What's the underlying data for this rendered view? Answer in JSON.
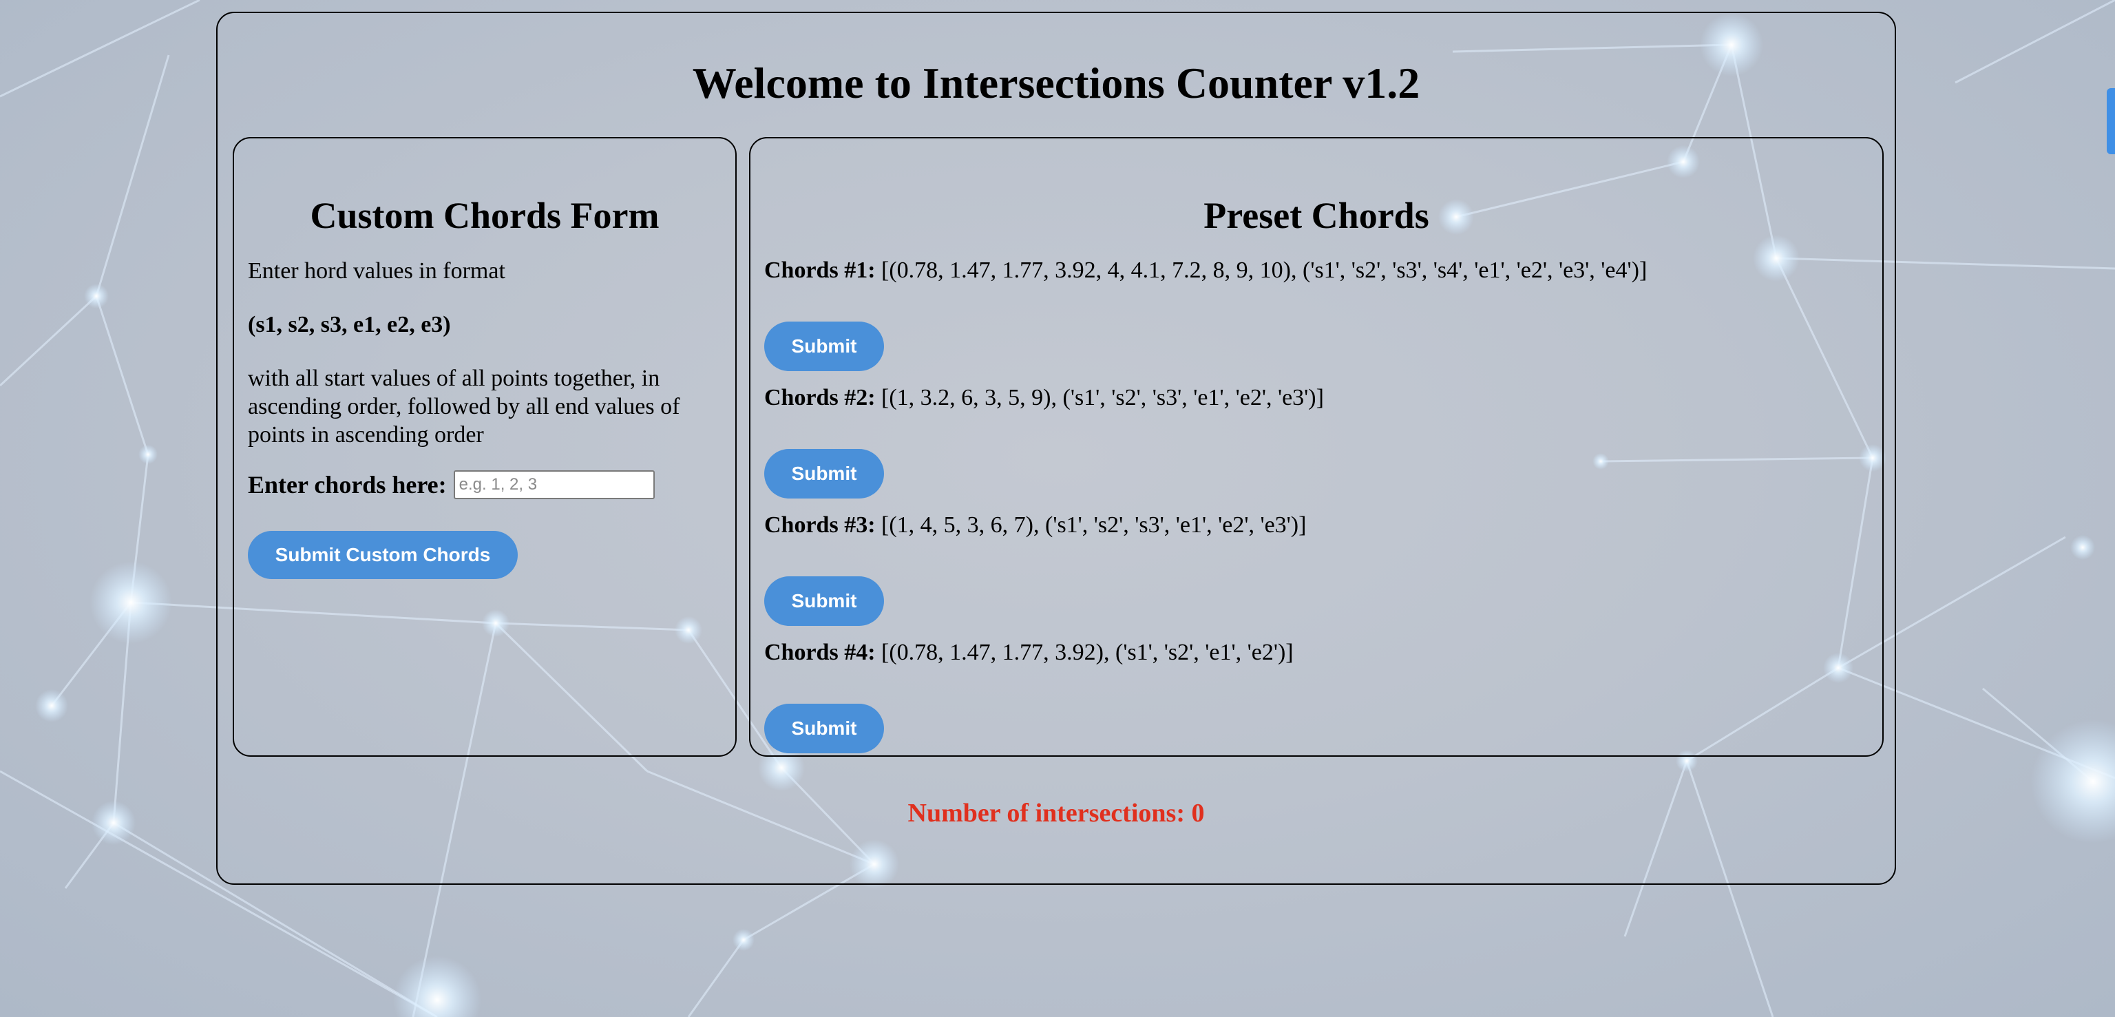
{
  "header": {
    "title": "Welcome to Intersections Counter v1.2"
  },
  "custom_form": {
    "title": "Custom Chords Form",
    "intro": "Enter hord values in format",
    "format": "(s1, s2, s3, e1, e2, e3)",
    "description": "with all start values of all points together, in ascending order, followed by all end values of points in ascending order",
    "input_label": "Enter chords here:",
    "input_placeholder": "e.g. 1, 2, 3",
    "input_value": "",
    "submit_label": "Submit Custom Chords"
  },
  "presets": {
    "title": "Preset Chords",
    "items": [
      {
        "label": "Chords #1:",
        "value": "[(0.78, 1.47, 1.77, 3.92, 4, 4.1, 7.2, 8, 9, 10), ('s1', 's2', 's3', 's4', 'e1', 'e2', 'e3', 'e4')]",
        "button": "Submit"
      },
      {
        "label": "Chords #2:",
        "value": "[(1, 3.2, 6, 3, 5, 9), ('s1', 's2', 's3', 'e1', 'e2', 'e3')]",
        "button": "Submit"
      },
      {
        "label": "Chords #3:",
        "value": "[(1, 4, 5, 3, 6, 7), ('s1', 's2', 's3', 'e1', 'e2', 'e3')]",
        "button": "Submit"
      },
      {
        "label": "Chords #4:",
        "value": "[(0.78, 1.47, 1.77, 3.92), ('s1', 's2', 'e1', 'e2')]",
        "button": "Submit"
      }
    ]
  },
  "result": {
    "text": "Number of intersections: 0"
  },
  "colors": {
    "accent": "#4a90d9",
    "result": "#e0301e",
    "scrollbar": "#3f8fe6"
  }
}
